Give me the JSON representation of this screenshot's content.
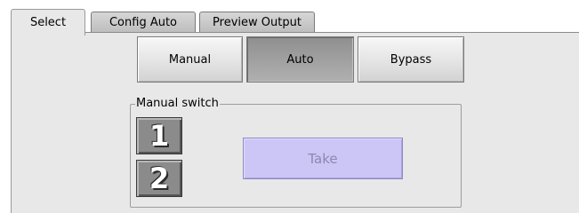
{
  "tabs": [
    {
      "label": "Select",
      "active": true
    },
    {
      "label": "Config Auto",
      "active": false
    },
    {
      "label": "Preview Output",
      "active": false
    }
  ],
  "mode_buttons": [
    {
      "label": "Manual",
      "selected": false
    },
    {
      "label": "Auto",
      "selected": true
    },
    {
      "label": "Bypass",
      "selected": false
    }
  ],
  "manual_switch": {
    "label": "Manual switch",
    "input_buttons": [
      "1",
      "2"
    ],
    "take_label": "Take",
    "take_enabled": false
  },
  "colors": {
    "panel_background": "#e8e8e8",
    "selected_mode": "#a3a3a3",
    "take_button": "#cbc6f6",
    "number_button": "#8b8b8b"
  },
  "icons": []
}
